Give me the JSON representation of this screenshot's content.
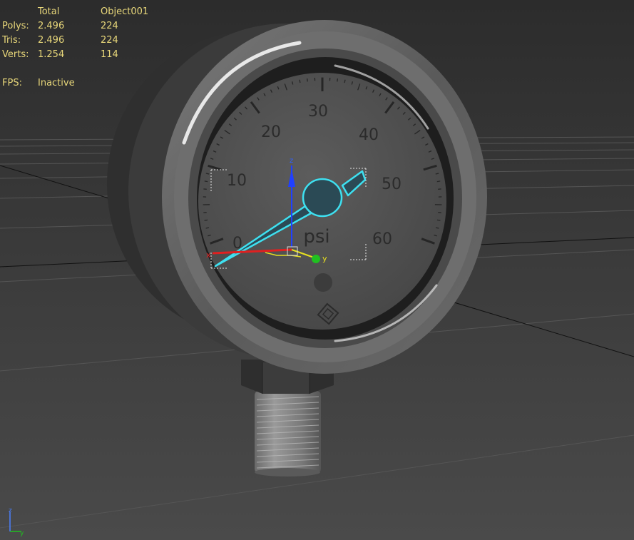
{
  "stats": {
    "header_total": "Total",
    "header_object": "Object001",
    "rows": [
      {
        "label": "Polys:",
        "total": "2.496",
        "object": "224"
      },
      {
        "label": "Tris:",
        "total": "2.496",
        "object": "224"
      },
      {
        "label": "Verts:",
        "total": "1.254",
        "object": "114"
      }
    ],
    "fps_label": "FPS:",
    "fps_value": "Inactive"
  },
  "gauge": {
    "dial_labels": [
      "0",
      "10",
      "20",
      "30",
      "40",
      "50",
      "60"
    ],
    "unit": "psi",
    "needle_value": 0
  },
  "gizmo": {
    "x": "x",
    "y": "y",
    "z": "z"
  },
  "view_axis": {
    "z": "z",
    "y": "y"
  },
  "colors": {
    "stats_text": "#e8d77a",
    "selection": "#3ee0f0",
    "axis_x": "#e02020",
    "axis_y": "#20c020",
    "axis_z": "#2040ff",
    "gizmo_plane": "#e8e020"
  }
}
